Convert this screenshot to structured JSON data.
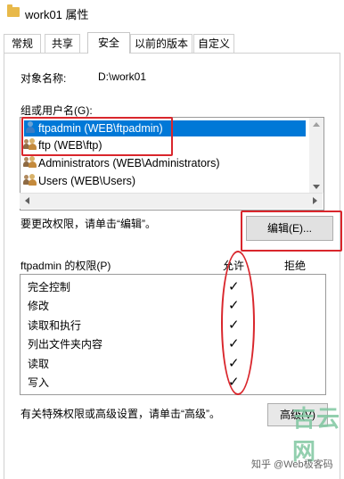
{
  "window": {
    "title": "work01 属性",
    "folder_icon": "folder-icon"
  },
  "tabs": [
    {
      "label": "常规"
    },
    {
      "label": "共享"
    },
    {
      "label": "安全",
      "active": true
    },
    {
      "label": "以前的版本"
    },
    {
      "label": "自定义"
    }
  ],
  "security": {
    "object_label": "对象名称:",
    "object_value": "D:\\work01",
    "groups_label": "组或用户名(G):",
    "users": [
      {
        "name": "ftpadmin (WEB\\ftpadmin)",
        "icon": "user-icon",
        "selected": true
      },
      {
        "name": "ftp (WEB\\ftp)",
        "icon": "group-icon",
        "selected": false
      },
      {
        "name": "Administrators (WEB\\Administrators)",
        "icon": "group-icon",
        "selected": false
      },
      {
        "name": "Users (WEB\\Users)",
        "icon": "group-icon",
        "selected": false
      }
    ],
    "change_hint": "要更改权限，请单击“编辑”。",
    "edit_button": "编辑(E)...",
    "perm_header": "ftpadmin 的权限(P)",
    "allow_header": "允许",
    "deny_header": "拒绝",
    "permissions": [
      {
        "name": "完全控制",
        "allow": true,
        "deny": false
      },
      {
        "name": "修改",
        "allow": true,
        "deny": false
      },
      {
        "name": "读取和执行",
        "allow": true,
        "deny": false
      },
      {
        "name": "列出文件夹内容",
        "allow": true,
        "deny": false
      },
      {
        "name": "读取",
        "allow": true,
        "deny": false
      },
      {
        "name": "写入",
        "allow": true,
        "deny": false
      }
    ],
    "check_glyph": "✓",
    "advanced_hint": "有关特殊权限或高级设置，请单击“高级”。",
    "advanced_button": "高级(V)"
  },
  "watermark": {
    "text": "知乎 @Web极客码",
    "logo": "吉云网"
  },
  "colors": {
    "selection": "#0078d7",
    "annotation": "#d9262c"
  }
}
